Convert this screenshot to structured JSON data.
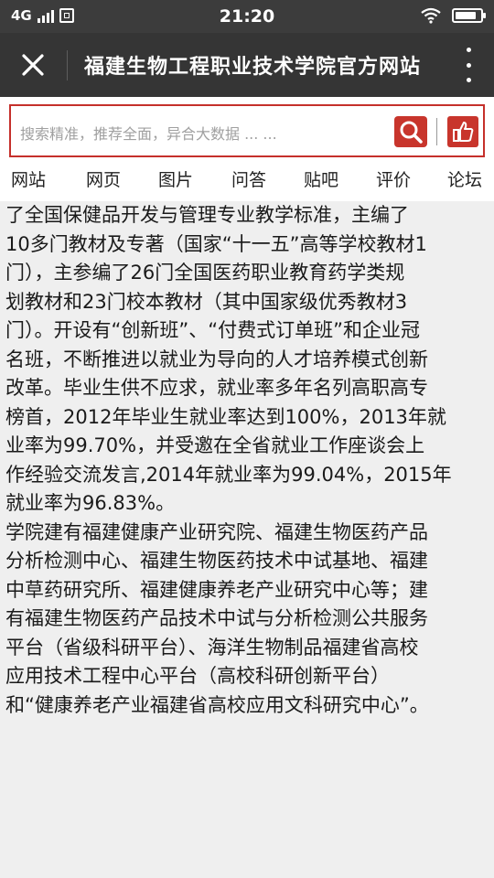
{
  "status_bar": {
    "network": "4G",
    "time": "21:20",
    "battery_level": 0.85
  },
  "title_bar": {
    "title": "福建生物工程职业技术学院官方网站",
    "close_icon": "close-icon",
    "more_icon": "more-vertical-icon"
  },
  "search": {
    "placeholder": "搜索精准，推荐全面，异合大数据 ... ...",
    "search_icon": "search-icon",
    "like_icon": "thumbs-up-icon",
    "accent_color": "#c8352c"
  },
  "nav_tabs": [
    "网站",
    "网页",
    "图片",
    "问答",
    "贴吧",
    "评价",
    "论坛"
  ],
  "article": {
    "paragraph_1_lines": [
      "了全国保健品开发与管理专业教学标准，主编了",
      "10多门教材及专著（国家“十一五”高等学校教材1",
      "门），主参编了26门全国医药职业教育药学类规",
      "划教材和23门校本教材（其中国家级优秀教材3",
      "门）。开设有“创新班”、“付费式订单班”和企业冠",
      "名班，不断推进以就业为导向的人才培养模式创新",
      "改革。毕业生供不应求，就业率多年名列高职高专",
      "榜首，2012年毕业生就业率达到100%，2013年就",
      "业率为99.70%，并受邀在全省就业工作座谈会上",
      "作经验交流发言,2014年就业率为99.04%，2015年",
      "就业率为96.83%。"
    ],
    "paragraph_2_lines": [
      "学院建有福建健康产业研究院、福建生物医药产品",
      "分析检测中心、福建生物医药技术中试基地、福建",
      "中草药研究所、福建健康养老产业研究中心等；建",
      "有福建生物医药产品技术中试与分析检测公共服务",
      "平台（省级科研平台）、海洋生物制品福建省高校",
      "应用技术工程中心平台（高校科研创新平台）",
      "和“健康养老产业福建省高校应用文科研究中心”。"
    ]
  }
}
